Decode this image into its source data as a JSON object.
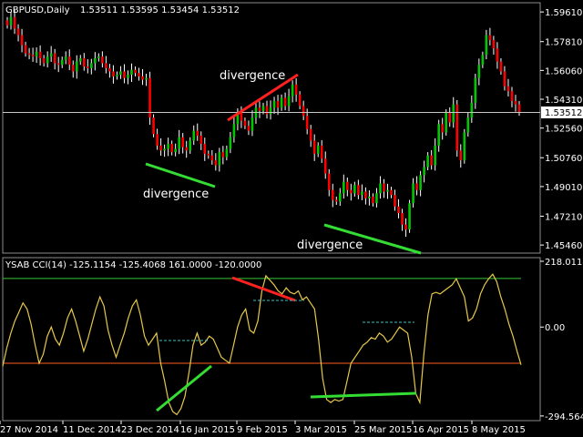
{
  "chart_data": [
    {
      "type": "candlestick",
      "header": {
        "symbol": "GBPUSD,Daily",
        "ohlc": "1.53511 1.53595 1.53454 1.53512"
      },
      "colors": {
        "up": "#00c800",
        "down": "#ff0000",
        "wick": "#ffffff",
        "price_line": "#c8c8c8",
        "divergence_price": "#ff2020",
        "divergence_green": "#33dd33"
      },
      "y_axis": {
        "ticks": [
          "1.59610",
          "1.57810",
          "1.56060",
          "1.54310",
          "1.52560",
          "1.50760",
          "1.49010",
          "1.47210",
          "1.45460"
        ],
        "ylim": [
          1.4497,
          1.6017
        ]
      },
      "current_price_label": "1.53512",
      "current_price": 1.53512,
      "annotations": [
        "divergence",
        "divergence",
        "divergence"
      ],
      "closes": [
        1.588,
        1.593,
        1.586,
        1.582,
        1.576,
        1.571,
        1.57,
        1.569,
        1.572,
        1.568,
        1.565,
        1.569,
        1.571,
        1.565,
        1.564,
        1.567,
        1.569,
        1.564,
        1.56,
        1.566,
        1.568,
        1.563,
        1.562,
        1.565,
        1.568,
        1.569,
        1.565,
        1.562,
        1.56,
        1.557,
        1.558,
        1.56,
        1.556,
        1.558,
        1.561,
        1.559,
        1.557,
        1.555,
        1.556,
        1.532,
        1.522,
        1.515,
        1.512,
        1.513,
        1.516,
        1.511,
        1.513,
        1.52,
        1.514,
        1.512,
        1.518,
        1.524,
        1.521,
        1.516,
        1.51,
        1.509,
        1.506,
        1.503,
        1.511,
        1.508,
        1.513,
        1.52,
        1.528,
        1.535,
        1.53,
        1.527,
        1.524,
        1.532,
        1.538,
        1.536,
        1.539,
        1.534,
        1.538,
        1.542,
        1.538,
        1.544,
        1.539,
        1.545,
        1.552,
        1.546,
        1.539,
        1.533,
        1.525,
        1.518,
        1.51,
        1.515,
        1.507,
        1.498,
        1.488,
        1.482,
        1.481,
        1.486,
        1.493,
        1.488,
        1.486,
        1.491,
        1.485,
        1.487,
        1.483,
        1.484,
        1.48,
        1.486,
        1.492,
        1.487,
        1.488,
        1.485,
        1.478,
        1.474,
        1.467,
        1.464,
        1.48,
        1.492,
        1.488,
        1.497,
        1.502,
        1.509,
        1.503,
        1.515,
        1.528,
        1.523,
        1.535,
        1.529,
        1.54,
        1.512,
        1.506,
        1.523,
        1.532,
        1.541,
        1.556,
        1.564,
        1.57,
        1.582,
        1.579,
        1.574,
        1.566,
        1.56,
        1.551,
        1.548,
        1.542,
        1.54,
        1.5351
      ]
    },
    {
      "type": "line",
      "header": "YSAB CCI(14) -125.1154 -125.4068 161.0000 -120.0000",
      "colors": {
        "cci": "#e6c84a",
        "upper": "#32c832",
        "lower": "#ff6020",
        "dotted": "#40c0c0",
        "div_red": "#ff2020",
        "div_green": "#33dd33"
      },
      "y_axis": {
        "ticks": [
          "218.0114",
          "0.00",
          "-294.5640"
        ],
        "ylim": [
          -310,
          230
        ]
      },
      "levels": [
        161,
        -120
      ],
      "values": [
        -130,
        -70,
        -20,
        20,
        50,
        80,
        60,
        10,
        -60,
        -120,
        -90,
        -30,
        0,
        -40,
        -60,
        -20,
        30,
        60,
        20,
        -30,
        -80,
        -40,
        10,
        60,
        100,
        70,
        -10,
        -60,
        -100,
        -60,
        -20,
        30,
        70,
        90,
        40,
        -30,
        -60,
        -40,
        -20,
        -120,
        -180,
        -250,
        -280,
        -290,
        -270,
        -230,
        -150,
        -60,
        -20,
        -60,
        -50,
        -30,
        -40,
        -70,
        -100,
        -110,
        -120,
        -60,
        0,
        40,
        60,
        -10,
        -20,
        20,
        120,
        170,
        155,
        140,
        120,
        110,
        130,
        115,
        110,
        120,
        90,
        100,
        80,
        60,
        -40,
        -170,
        -240,
        -250,
        -240,
        -245,
        -240,
        -180,
        -120,
        -100,
        -80,
        -60,
        -50,
        -35,
        -40,
        -20,
        -30,
        -50,
        -40,
        -20,
        0,
        -10,
        -20,
        -100,
        -220,
        -250,
        -90,
        40,
        110,
        115,
        110,
        120,
        130,
        140,
        160,
        130,
        100,
        20,
        30,
        60,
        110,
        140,
        160,
        175,
        150,
        100,
        60,
        10,
        -30,
        -80,
        -125
      ]
    }
  ],
  "x_axis": {
    "tick_labels": [
      "27 Nov 2014",
      "11 Dec 2014",
      "23 Dec 2014",
      "16 Jan 2015",
      "9 Feb 2015",
      "3 Mar 2015",
      "25 Mar 2015",
      "16 Apr 2015",
      "8 May 2015"
    ]
  }
}
